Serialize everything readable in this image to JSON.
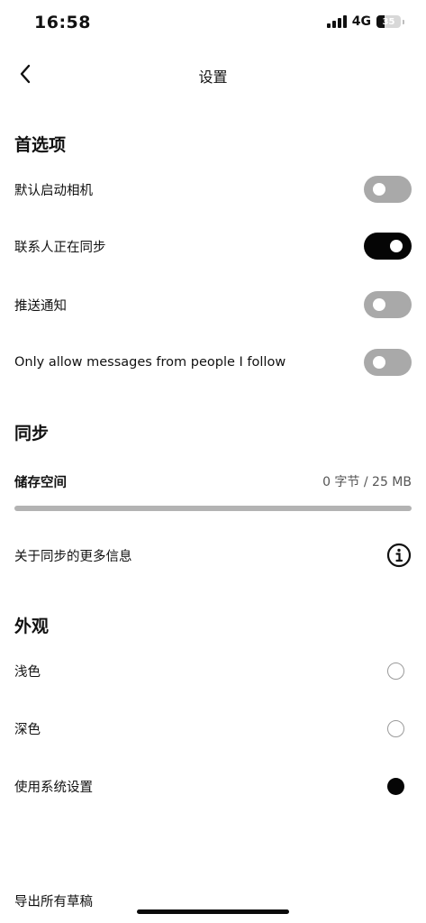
{
  "status": {
    "time": "16:58",
    "network": "4G",
    "battery": "35",
    "battery_fraction": 0.35
  },
  "nav": {
    "title": "设置"
  },
  "preferences": {
    "title": "首选项",
    "items": [
      {
        "label": "默认启动相机",
        "on": false
      },
      {
        "label": "联系人正在同步",
        "on": true
      },
      {
        "label": "推送通知",
        "on": false
      },
      {
        "label": "Only allow messages from people I follow",
        "on": false
      }
    ]
  },
  "sync": {
    "title": "同步",
    "storage_label": "储存空间",
    "storage_value": "0 字节 / 25 MB",
    "storage_used_fraction": 0.0,
    "more_info_label": "关于同步的更多信息"
  },
  "appearance": {
    "title": "外观",
    "options": [
      {
        "label": "浅色",
        "selected": false
      },
      {
        "label": "深色",
        "selected": false
      },
      {
        "label": "使用系统设置",
        "selected": true
      }
    ]
  },
  "export_label": "导出所有草稿"
}
